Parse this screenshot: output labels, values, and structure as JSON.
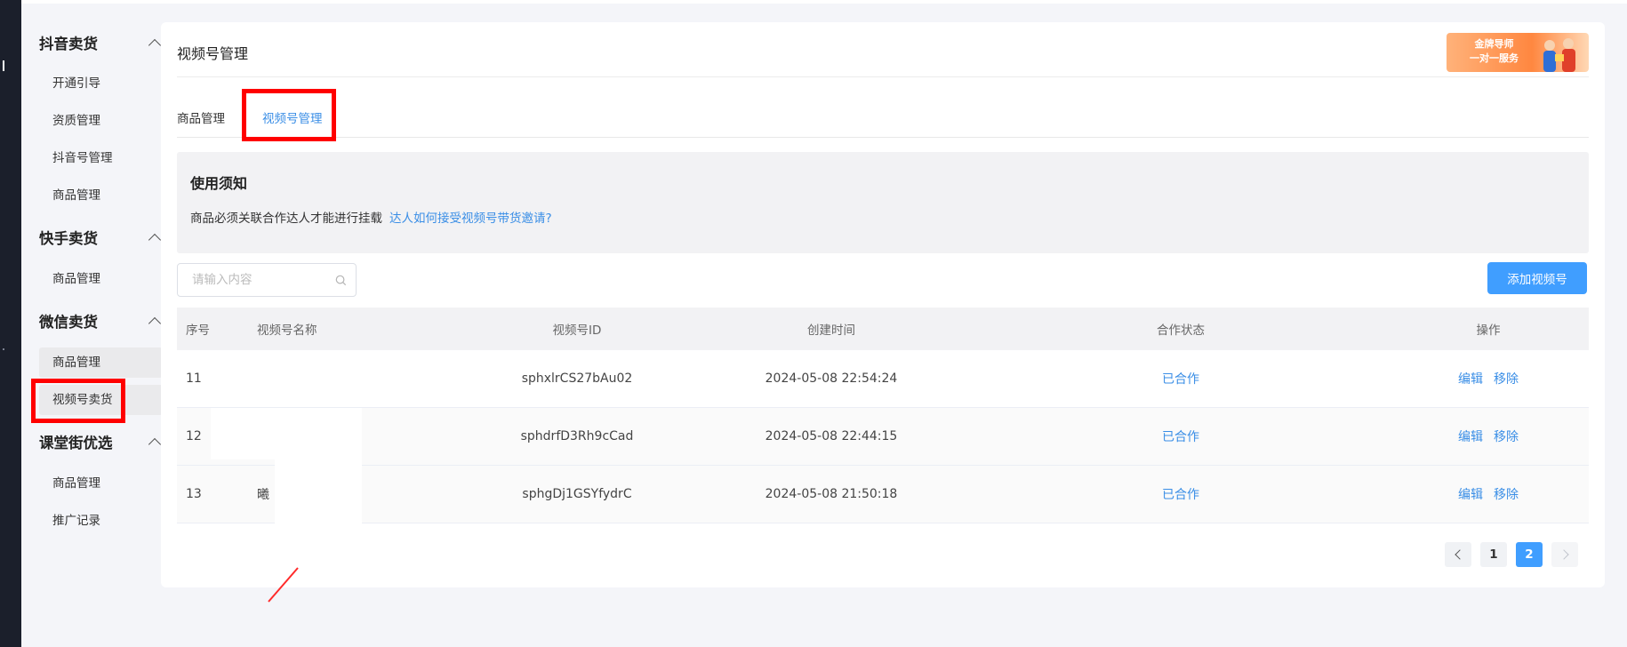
{
  "sidebar": {
    "sections": [
      {
        "title": "抖音卖货",
        "items": [
          "开通引导",
          "资质管理",
          "抖音号管理",
          "商品管理"
        ]
      },
      {
        "title": "快手卖货",
        "items": [
          "商品管理"
        ]
      },
      {
        "title": "微信卖货",
        "items": [
          "商品管理",
          "视频号卖货"
        ]
      },
      {
        "title": "课堂街优选",
        "items": [
          "商品管理",
          "推广记录"
        ]
      }
    ],
    "active_item": "视频号卖货"
  },
  "page": {
    "title": "视频号管理",
    "banner": {
      "line1": "金牌导师",
      "line2": "一对一服务"
    }
  },
  "tabs": [
    {
      "label": "商品管理",
      "active": false
    },
    {
      "label": "视频号管理",
      "active": true
    }
  ],
  "notice": {
    "title": "使用须知",
    "text": "商品必须关联合作达人才能进行挂载",
    "link": "达人如何接受视频号带货邀请?"
  },
  "search": {
    "placeholder": "请输入内容",
    "value": ""
  },
  "add_button": "添加视频号",
  "table": {
    "headers": [
      "序号",
      "视频号名称",
      "视频号ID",
      "创建时间",
      "合作状态",
      "操作"
    ],
    "rows": [
      {
        "no": "11",
        "name": "",
        "id": "sphxlrCS27bAu02",
        "created": "2024-05-08 22:54:24",
        "status": "已合作",
        "edit": "编辑",
        "remove": "移除"
      },
      {
        "no": "12",
        "name": "",
        "id": "sphdrfD3Rh9cCad",
        "created": "2024-05-08 22:44:15",
        "status": "已合作",
        "edit": "编辑",
        "remove": "移除"
      },
      {
        "no": "13",
        "name": "曦",
        "id": "sphgDj1GSYfydrC",
        "created": "2024-05-08 21:50:18",
        "status": "已合作",
        "edit": "编辑",
        "remove": "移除"
      }
    ]
  },
  "pagination": {
    "pages": [
      "1",
      "2"
    ],
    "current": "2"
  },
  "colors": {
    "accent": "#409eff",
    "link": "#3a8ee6",
    "highlight_box": "#ff0000"
  }
}
